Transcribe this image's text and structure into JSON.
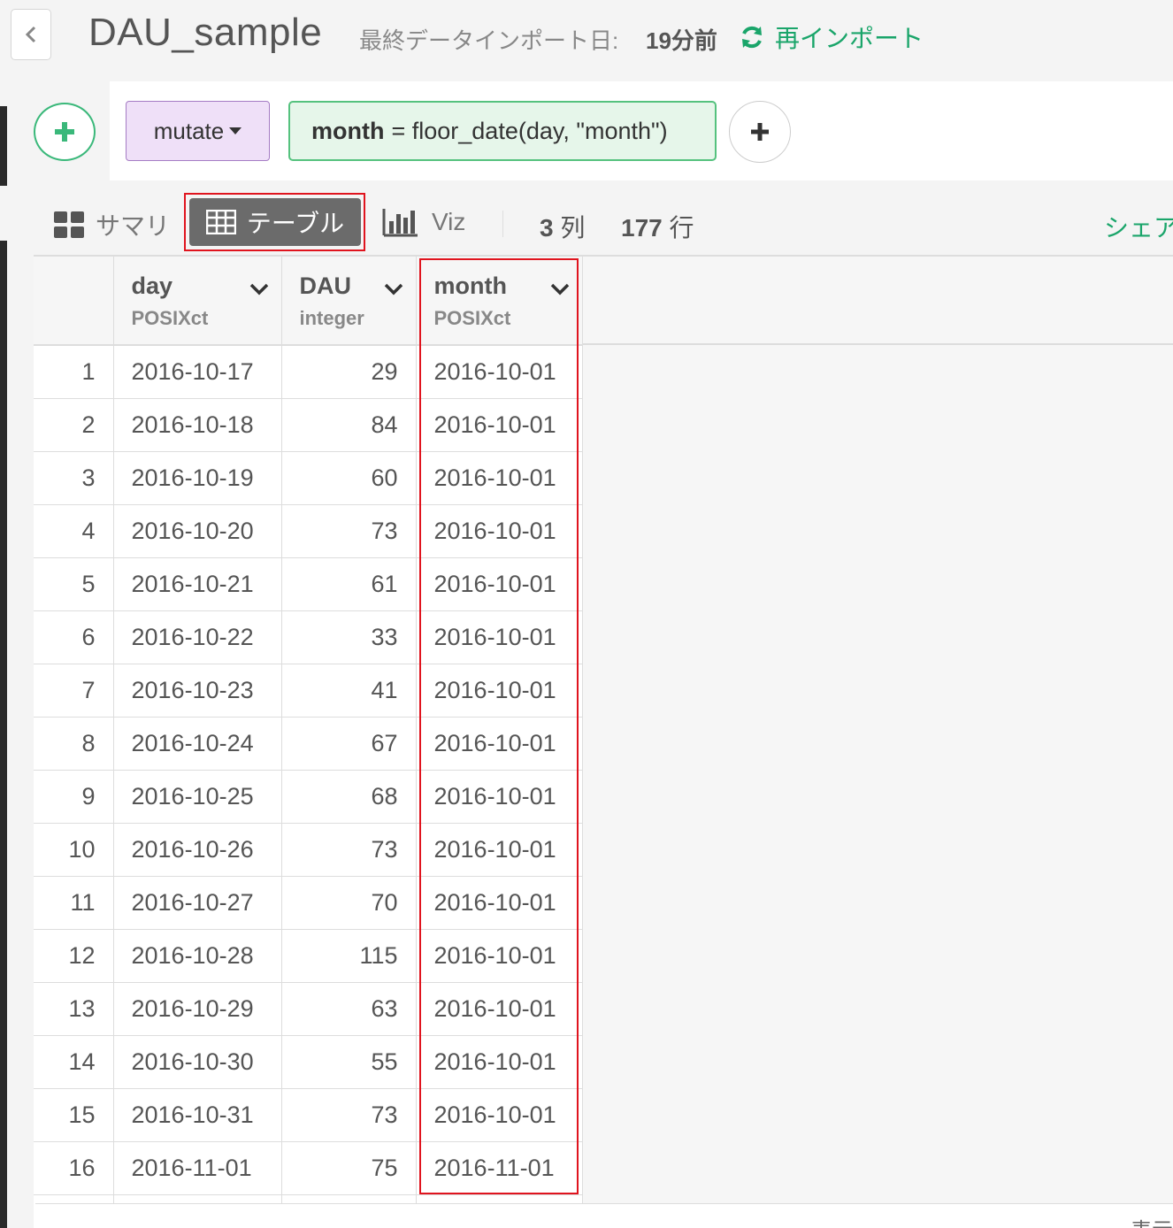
{
  "header": {
    "title": "DAU_sample",
    "import_label": "最終データインポート日:",
    "import_value": "19分前",
    "reimport_label": "再インポート"
  },
  "steps": {
    "command_label": "mutate",
    "expression_column": "month",
    "expression_rest": "= floor_date(day, \"month\")"
  },
  "view_tabs": {
    "summary_label": "サマリ",
    "table_label": "テーブル",
    "viz_label": "Viz",
    "share_label": "シェア"
  },
  "counts": {
    "columns_value": "3",
    "columns_unit": "列",
    "rows_value": "177",
    "rows_unit": "行"
  },
  "table": {
    "columns": [
      {
        "name": "day",
        "type": "POSIXct"
      },
      {
        "name": "DAU",
        "type": "integer"
      },
      {
        "name": "month",
        "type": "POSIXct"
      }
    ],
    "rows": [
      {
        "index": "1",
        "day": "2016-10-17",
        "dau": "29",
        "month": "2016-10-01"
      },
      {
        "index": "2",
        "day": "2016-10-18",
        "dau": "84",
        "month": "2016-10-01"
      },
      {
        "index": "3",
        "day": "2016-10-19",
        "dau": "60",
        "month": "2016-10-01"
      },
      {
        "index": "4",
        "day": "2016-10-20",
        "dau": "73",
        "month": "2016-10-01"
      },
      {
        "index": "5",
        "day": "2016-10-21",
        "dau": "61",
        "month": "2016-10-01"
      },
      {
        "index": "6",
        "day": "2016-10-22",
        "dau": "33",
        "month": "2016-10-01"
      },
      {
        "index": "7",
        "day": "2016-10-23",
        "dau": "41",
        "month": "2016-10-01"
      },
      {
        "index": "8",
        "day": "2016-10-24",
        "dau": "67",
        "month": "2016-10-01"
      },
      {
        "index": "9",
        "day": "2016-10-25",
        "dau": "68",
        "month": "2016-10-01"
      },
      {
        "index": "10",
        "day": "2016-10-26",
        "dau": "73",
        "month": "2016-10-01"
      },
      {
        "index": "11",
        "day": "2016-10-27",
        "dau": "70",
        "month": "2016-10-01"
      },
      {
        "index": "12",
        "day": "2016-10-28",
        "dau": "115",
        "month": "2016-10-01"
      },
      {
        "index": "13",
        "day": "2016-10-29",
        "dau": "63",
        "month": "2016-10-01"
      },
      {
        "index": "14",
        "day": "2016-10-30",
        "dau": "55",
        "month": "2016-10-01"
      },
      {
        "index": "15",
        "day": "2016-10-31",
        "dau": "73",
        "month": "2016-10-01"
      },
      {
        "index": "16",
        "day": "2016-11-01",
        "dau": "75",
        "month": "2016-11-01"
      }
    ]
  },
  "footer": {
    "text": "表示"
  },
  "colors": {
    "accent_green": "#1aa56a",
    "highlight_red": "#e0141e",
    "mutate_bg": "#efe0f8",
    "expression_bg": "#e6f6ea"
  },
  "icons": {
    "back": "chevron-left-icon",
    "reimport": "refresh-icon",
    "add_step": "plus-icon",
    "summary": "grid-icon",
    "table": "table-icon",
    "viz": "bar-chart-icon",
    "column_menu": "chevron-down-icon"
  }
}
